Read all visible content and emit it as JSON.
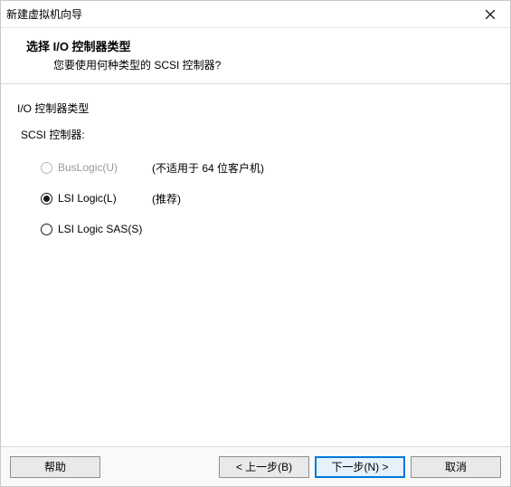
{
  "titlebar": {
    "title": "新建虚拟机向导"
  },
  "header": {
    "title": "选择 I/O 控制器类型",
    "subtitle": "您要使用何种类型的 SCSI 控制器?"
  },
  "content": {
    "section_label": "I/O 控制器类型",
    "scsi_label": "SCSI 控制器:",
    "options": [
      {
        "label": "BusLogic(U)",
        "note": "(不适用于 64 位客户机)",
        "disabled": true,
        "selected": false
      },
      {
        "label": "LSI Logic(L)",
        "note": "(推荐)",
        "disabled": false,
        "selected": true
      },
      {
        "label": "LSI Logic SAS(S)",
        "note": "",
        "disabled": false,
        "selected": false
      }
    ]
  },
  "footer": {
    "help": "帮助",
    "back": "< 上一步(B)",
    "next": "下一步(N) >",
    "cancel": "取消"
  }
}
